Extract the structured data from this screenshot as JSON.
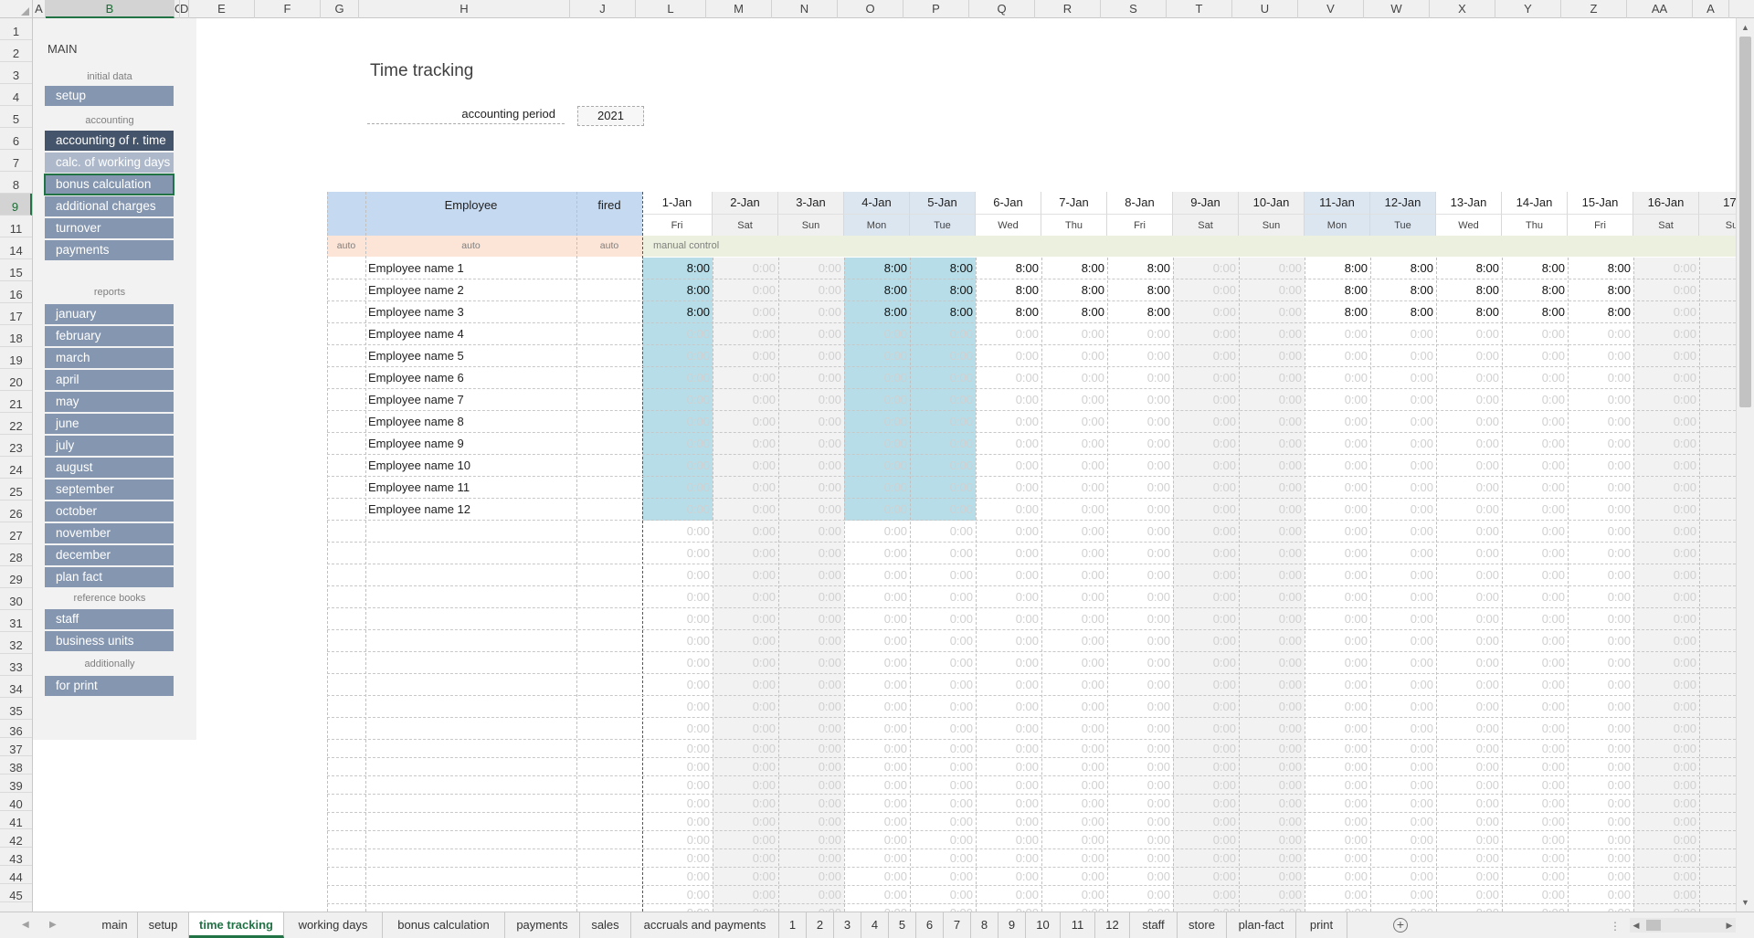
{
  "columns": [
    {
      "label": "A",
      "w": 14
    },
    {
      "label": "B",
      "w": 141,
      "selected": true
    },
    {
      "label": "C",
      "w": 6
    },
    {
      "label": "D",
      "w": 10
    },
    {
      "label": "E",
      "w": 72
    },
    {
      "label": "F",
      "w": 72
    },
    {
      "label": "G",
      "w": 42
    },
    {
      "label": "H",
      "w": 231
    },
    {
      "label": "J",
      "w": 72
    },
    {
      "label": "L",
      "w": 77
    },
    {
      "label": "M",
      "w": 72
    },
    {
      "label": "N",
      "w": 72
    },
    {
      "label": "O",
      "w": 72
    },
    {
      "label": "P",
      "w": 72
    },
    {
      "label": "Q",
      "w": 72
    },
    {
      "label": "R",
      "w": 72
    },
    {
      "label": "S",
      "w": 72
    },
    {
      "label": "T",
      "w": 72
    },
    {
      "label": "U",
      "w": 72
    },
    {
      "label": "V",
      "w": 72
    },
    {
      "label": "W",
      "w": 72
    },
    {
      "label": "X",
      "w": 72
    },
    {
      "label": "Y",
      "w": 72
    },
    {
      "label": "Z",
      "w": 72
    },
    {
      "label": "AA",
      "w": 72
    },
    {
      "label": "A",
      "w": 40
    }
  ],
  "rows": [
    "1",
    "2",
    "3",
    "4",
    "5",
    "6",
    "7",
    "8",
    "9",
    "11",
    "14",
    "15",
    "16",
    "17",
    "18",
    "19",
    "20",
    "21",
    "22",
    "23",
    "24",
    "25",
    "26",
    "27",
    "28",
    "29",
    "30",
    "31",
    "32",
    "33",
    "34",
    "35",
    "36",
    "37",
    "38",
    "39",
    "40",
    "41",
    "42",
    "43",
    "44",
    "45"
  ],
  "selected_row": "9",
  "sidebar": {
    "title": "MAIN",
    "sections": {
      "initial": "initial data",
      "accounting": "accounting",
      "reports": "reports",
      "reference": "reference books",
      "additionally": "additionally"
    },
    "buttons": {
      "setup": "setup",
      "accounting_time": "accounting of r. time",
      "working_days": "calc. of working days",
      "bonus": "bonus calculation",
      "additional": "additional charges",
      "turnover": "turnover",
      "payments": "payments",
      "months": [
        "january",
        "february",
        "march",
        "april",
        "may",
        "june",
        "july",
        "august",
        "september",
        "october",
        "november",
        "december"
      ],
      "plan_fact": "plan fact",
      "staff": "staff",
      "business_units": "business units",
      "for_print": "for print"
    }
  },
  "sheet": {
    "title": "Time tracking",
    "period_label": "accounting period",
    "period_value": "2021",
    "employee_header": "Employee",
    "fired_header": "fired",
    "auto_label": "auto",
    "manual_label": "manual control",
    "dates": [
      {
        "date": "1-Jan",
        "day": "Fri",
        "hl": true
      },
      {
        "date": "2-Jan",
        "day": "Sat",
        "we": true
      },
      {
        "date": "3-Jan",
        "day": "Sun",
        "we": true
      },
      {
        "date": "4-Jan",
        "day": "Mon",
        "hl": true
      },
      {
        "date": "5-Jan",
        "day": "Tue",
        "hl": true
      },
      {
        "date": "6-Jan",
        "day": "Wed"
      },
      {
        "date": "7-Jan",
        "day": "Thu"
      },
      {
        "date": "8-Jan",
        "day": "Fri"
      },
      {
        "date": "9-Jan",
        "day": "Sat",
        "we": true
      },
      {
        "date": "10-Jan",
        "day": "Sun",
        "we": true
      },
      {
        "date": "11-Jan",
        "day": "Mon"
      },
      {
        "date": "12-Jan",
        "day": "Tue"
      },
      {
        "date": "13-Jan",
        "day": "Wed"
      },
      {
        "date": "14-Jan",
        "day": "Thu"
      },
      {
        "date": "15-Jan",
        "day": "Fri"
      },
      {
        "date": "16-Jan",
        "day": "Sat",
        "we": true
      },
      {
        "date": "17-",
        "day": "Su",
        "we": true
      }
    ],
    "employees": [
      "Employee name 1",
      "Employee name 2",
      "Employee name 3",
      "Employee name 4",
      "Employee name 5",
      "Employee name 6",
      "Employee name 7",
      "Employee name 8",
      "Employee name 9",
      "Employee name 10",
      "Employee name 11",
      "Employee name 12"
    ],
    "worked_rows": 3,
    "work_value": "8:00",
    "zero_value": "0:00"
  },
  "tabs": [
    "main",
    "setup",
    "time tracking",
    "working days",
    "bonus calculation",
    "payments",
    "sales",
    "accruals and payments",
    "1",
    "2",
    "3",
    "4",
    "5",
    "6",
    "7",
    "8",
    "9",
    "10",
    "11",
    "12",
    "staff",
    "store",
    "plan-fact",
    "print"
  ],
  "active_tab": "time tracking",
  "tab_bar": {
    "prev_icon": "◀",
    "next_icon": "▶",
    "add_icon": "+",
    "split_icon": "⋮"
  },
  "scrollbar": {
    "up": "▲",
    "down": "▼",
    "left": "◀",
    "right": "▶"
  }
}
